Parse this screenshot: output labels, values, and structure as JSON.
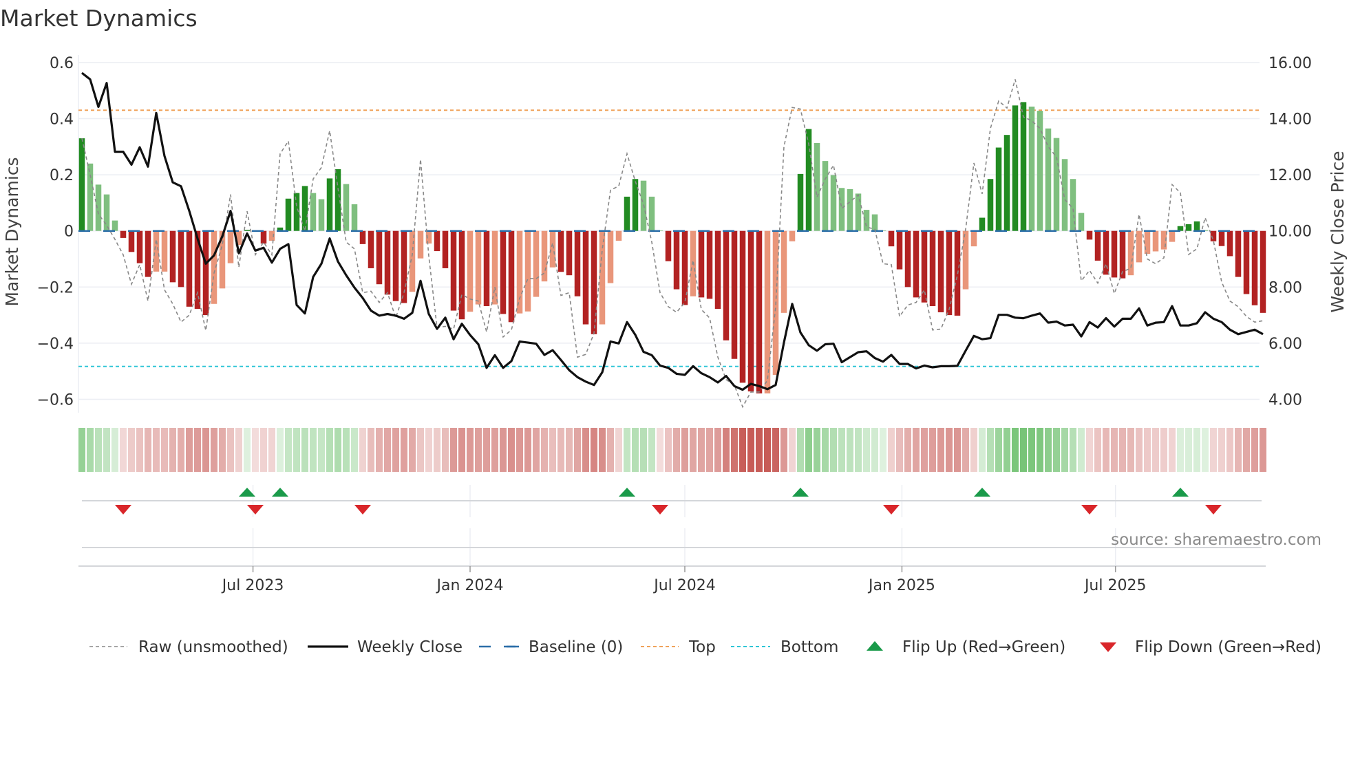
{
  "title": "Market Dynamics",
  "source": "source: sharemaestro.com",
  "colors": {
    "up_strong": "#228b22",
    "up_weak": "#7fbf7f",
    "down_strong": "#b22222",
    "down_weak": "#e9967a",
    "close": "#111111",
    "raw": "#888888",
    "baseline": "#2b6ea8",
    "top": "#f0a25a",
    "bottom": "#2fc6d6",
    "flip_up": "#1a9a4a",
    "flip_down": "#d9262a",
    "regime_green": "#5cb85c",
    "regime_red": "#c4534e",
    "grid": "#eceef3"
  },
  "legend": [
    {
      "key": "raw",
      "label": "Raw (unsmoothed)"
    },
    {
      "key": "close",
      "label": "Weekly Close"
    },
    {
      "key": "baseline",
      "label": "Baseline (0)"
    },
    {
      "key": "top",
      "label": "Top"
    },
    {
      "key": "bottom",
      "label": "Bottom"
    },
    {
      "key": "flip_up",
      "label": "Flip Up (Red→Green)"
    },
    {
      "key": "flip_down",
      "label": "Flip Down (Green→Red)"
    }
  ],
  "chart_data": {
    "type": "bar",
    "title": "Market Dynamics",
    "ylabel": "Market Dynamics",
    "y2label": "Weekly Close Price",
    "ylim": [
      -0.6,
      0.6
    ],
    "y2lim": [
      4,
      16
    ],
    "yticks": [
      "0.6",
      "0.4",
      "0.2",
      "0",
      "−0.2",
      "−0.4",
      "−0.6"
    ],
    "ytick_values": [
      0.6,
      0.4,
      0.2,
      0,
      -0.2,
      -0.4,
      -0.6
    ],
    "y2ticks": [
      "16.00",
      "14.00",
      "12.00",
      "10.00",
      "8.00",
      "6.00",
      "4.00"
    ],
    "y2tick_values": [
      16,
      14,
      12,
      10,
      8,
      6,
      4
    ],
    "grid": true,
    "legend_position": "bottom",
    "x_start": "2023-02-06",
    "x_step_days": 7,
    "xticks": [
      {
        "date": "2023-07-01",
        "label": "Jul 2023"
      },
      {
        "date": "2024-01-01",
        "label": "Jan 2024"
      },
      {
        "date": "2024-07-01",
        "label": "Jul 2024"
      },
      {
        "date": "2025-01-01",
        "label": "Jan 2025"
      },
      {
        "date": "2025-07-01",
        "label": "Jul 2025"
      }
    ],
    "top_level": 0.43,
    "bottom_level": -0.483,
    "baseline": 0,
    "dynamics": [
      0.33,
      0.24,
      0.165,
      0.13,
      0.037,
      -0.025,
      -0.075,
      -0.115,
      -0.164,
      -0.145,
      -0.145,
      -0.183,
      -0.2,
      -0.27,
      -0.278,
      -0.3,
      -0.26,
      -0.205,
      -0.115,
      -0.05,
      0.004,
      -0.003,
      -0.045,
      -0.035,
      0.012,
      0.115,
      0.135,
      0.16,
      0.135,
      0.113,
      0.187,
      0.22,
      0.167,
      0.095,
      -0.047,
      -0.133,
      -0.19,
      -0.227,
      -0.25,
      -0.257,
      -0.217,
      -0.098,
      -0.045,
      -0.072,
      -0.133,
      -0.284,
      -0.315,
      -0.288,
      -0.262,
      -0.268,
      -0.262,
      -0.296,
      -0.325,
      -0.294,
      -0.287,
      -0.235,
      -0.18,
      -0.13,
      -0.146,
      -0.158,
      -0.233,
      -0.333,
      -0.368,
      -0.333,
      -0.186,
      -0.035,
      0.122,
      0.185,
      0.179,
      0.122,
      0.002,
      -0.108,
      -0.208,
      -0.264,
      -0.233,
      -0.237,
      -0.242,
      -0.278,
      -0.39,
      -0.456,
      -0.541,
      -0.572,
      -0.579,
      -0.579,
      -0.513,
      -0.292,
      -0.037,
      0.203,
      0.363,
      0.313,
      0.249,
      0.199,
      0.153,
      0.149,
      0.133,
      0.075,
      0.059,
      0.002,
      -0.055,
      -0.137,
      -0.2,
      -0.237,
      -0.255,
      -0.268,
      -0.29,
      -0.3,
      -0.302,
      -0.208,
      -0.055,
      0.047,
      0.185,
      0.297,
      0.342,
      0.447,
      0.459,
      0.443,
      0.428,
      0.365,
      0.331,
      0.256,
      0.185,
      0.064,
      -0.031,
      -0.106,
      -0.156,
      -0.166,
      -0.169,
      -0.158,
      -0.112,
      -0.082,
      -0.073,
      -0.066,
      -0.039,
      0.017,
      0.024,
      0.034,
      0.003,
      -0.037,
      -0.054,
      -0.09,
      -0.164,
      -0.225,
      -0.265,
      -0.292
    ],
    "raw": [
      0.33,
      0.2,
      0.06,
      0.02,
      -0.03,
      -0.085,
      -0.19,
      -0.12,
      -0.25,
      -0.03,
      -0.21,
      -0.26,
      -0.325,
      -0.3,
      -0.22,
      -0.355,
      -0.15,
      -0.05,
      0.13,
      -0.13,
      0.07,
      -0.085,
      -0.04,
      -0.085,
      0.275,
      0.32,
      0.087,
      0,
      0.185,
      0.226,
      0.357,
      0.153,
      -0.04,
      -0.064,
      -0.22,
      -0.215,
      -0.255,
      -0.22,
      -0.31,
      -0.22,
      -0.085,
      0.255,
      -0.09,
      -0.345,
      -0.34,
      -0.35,
      -0.227,
      -0.243,
      -0.25,
      -0.36,
      -0.2,
      -0.378,
      -0.353,
      -0.24,
      -0.17,
      -0.17,
      -0.15,
      -0.043,
      -0.23,
      -0.22,
      -0.45,
      -0.44,
      -0.365,
      -0.068,
      0.145,
      0.16,
      0.275,
      0.177,
      0.095,
      -0.04,
      -0.22,
      -0.27,
      -0.29,
      -0.255,
      -0.105,
      -0.28,
      -0.31,
      -0.45,
      -0.53,
      -0.55,
      -0.627,
      -0.574,
      -0.574,
      -0.533,
      -0.27,
      0.3,
      0.44,
      0.434,
      0.31,
      0.12,
      0.185,
      0.234,
      0.08,
      0.104,
      0.128,
      0.014,
      0.006,
      -0.117,
      -0.12,
      -0.305,
      -0.264,
      -0.255,
      -0.21,
      -0.353,
      -0.35,
      -0.28,
      -0.158,
      0.006,
      0.242,
      0.132,
      0.365,
      0.463,
      0.438,
      0.54,
      0.406,
      0.393,
      0.365,
      0.3,
      0.263,
      0.112,
      0.08,
      -0.178,
      -0.141,
      -0.186,
      -0.117,
      -0.223,
      -0.145,
      -0.133,
      0.059,
      -0.1,
      -0.117,
      -0.096,
      0.165,
      0.136,
      -0.084,
      -0.064,
      0.047,
      -0.035,
      -0.182,
      -0.25,
      -0.27,
      -0.305,
      -0.325,
      -0.32
    ],
    "weekly_close": [
      15.63,
      15.4,
      14.42,
      15.27,
      12.82,
      12.82,
      12.36,
      12.98,
      12.29,
      14.2,
      12.67,
      11.73,
      11.59,
      10.71,
      9.73,
      8.83,
      9.13,
      9.81,
      10.71,
      9.2,
      9.91,
      9.3,
      9.4,
      8.87,
      9.36,
      9.53,
      7.36,
      7.06,
      8.36,
      8.83,
      9.73,
      8.91,
      8.42,
      7.98,
      7.61,
      7.16,
      6.98,
      7.04,
      6.98,
      6.87,
      7.08,
      8.22,
      7.04,
      6.51,
      6.91,
      6.14,
      6.69,
      6.29,
      5.96,
      5.12,
      5.57,
      5.12,
      5.36,
      6.06,
      6.02,
      5.98,
      5.58,
      5.75,
      5.4,
      5.04,
      4.79,
      4.63,
      4.51,
      4.96,
      6.06,
      5.99,
      6.75,
      6.3,
      5.69,
      5.57,
      5.2,
      5.12,
      4.91,
      4.87,
      5.18,
      4.93,
      4.79,
      4.6,
      4.83,
      4.47,
      4.34,
      4.55,
      4.47,
      4.36,
      4.51,
      6.02,
      7.4,
      6.38,
      5.93,
      5.73,
      5.96,
      5.98,
      5.32,
      5.5,
      5.68,
      5.71,
      5.47,
      5.34,
      5.58,
      5.26,
      5.26,
      5.1,
      5.2,
      5.14,
      5.18,
      5.18,
      5.19,
      5.73,
      6.26,
      6.14,
      6.18,
      7.01,
      7.01,
      6.91,
      6.89,
      6.98,
      7.06,
      6.73,
      6.77,
      6.63,
      6.66,
      6.24,
      6.75,
      6.56,
      6.89,
      6.59,
      6.87,
      6.87,
      7.24,
      6.63,
      6.73,
      6.75,
      7.32,
      6.63,
      6.63,
      6.71,
      7.1,
      6.87,
      6.75,
      6.48,
      6.32,
      6.4,
      6.48,
      6.32
    ],
    "flips_up": [
      "2023-06-26",
      "2023-07-24",
      "2024-05-13",
      "2024-10-07",
      "2025-03-10",
      "2025-08-25"
    ],
    "flips_down": [
      "2023-03-13",
      "2023-07-03",
      "2023-10-02",
      "2024-06-10",
      "2024-12-23",
      "2025-06-09",
      "2025-09-22"
    ],
    "initial_regime": "green"
  }
}
